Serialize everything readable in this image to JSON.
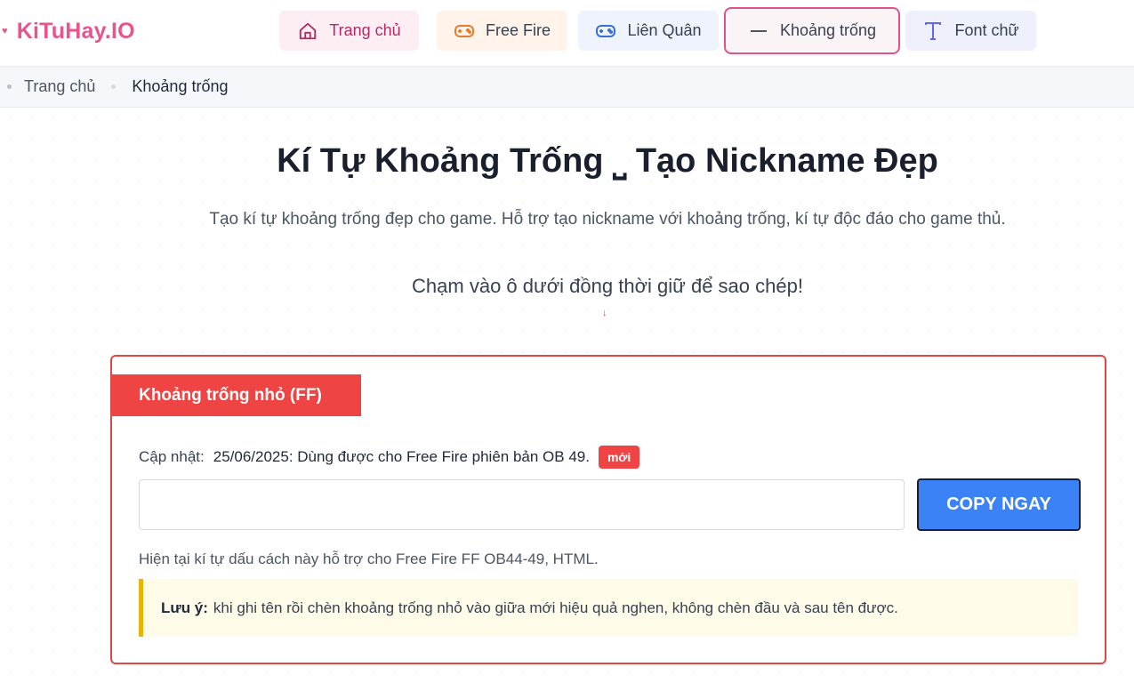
{
  "header": {
    "logo": "KiTuHay.IO",
    "nav": [
      {
        "label": "Trang chủ",
        "icon": "home-icon"
      },
      {
        "label": "Free Fire",
        "icon": "gamepad-icon"
      },
      {
        "label": "Liên Quân",
        "icon": "gamepad-icon"
      },
      {
        "label": "Khoảng trống",
        "icon": "minus-icon",
        "active": true
      },
      {
        "label": "Font chữ",
        "icon": "text-icon"
      }
    ]
  },
  "breadcrumb": {
    "home": "Trang chủ",
    "current": "Khoảng trống"
  },
  "hero": {
    "title": "Kí Tự Khoảng Trống ⎵ Tạo Nickname Đẹp",
    "subtitle": "Tạo kí tự khoảng trống đẹp cho game. Hỗ trợ tạo nickname với khoảng trống, kí tự độc đáo cho game thủ.",
    "instruction": "Chạm vào ô dưới đồng thời giữ để sao chép!",
    "arrow": "↓"
  },
  "card": {
    "badge": "Khoảng trống nhỏ (FF)",
    "update_label": "Cập nhật:",
    "update_text": "25/06/2025: Dùng được cho Free Fire phiên bản OB 49.",
    "new_tag": "mới",
    "input_value": "",
    "copy_label": "COPY NGAY",
    "support_text": "Hiện tại kí tự dấu cách này hỗ trợ cho Free Fire FF OB44-49, HTML.",
    "note_label": "Lưu ý:",
    "note_text": "khi ghi tên rồi chèn khoảng trống nhỏ vào giữa mới hiệu quả nghen, không chèn đầu và sau tên được."
  },
  "colors": {
    "brand": "#e8558e",
    "accent_red": "#ef4444",
    "button_blue": "#3b82f6",
    "note_border": "#eab308"
  }
}
